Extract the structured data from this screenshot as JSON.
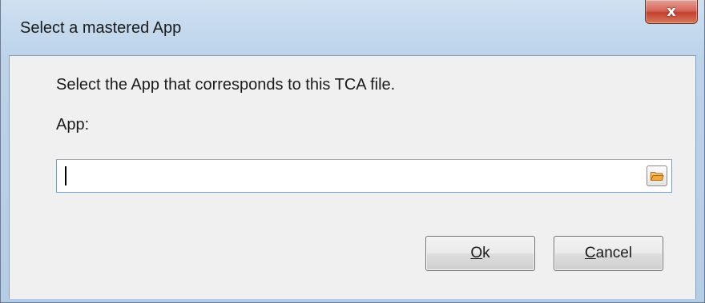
{
  "window": {
    "title": "Select a mastered App",
    "close_glyph": "x",
    "close_icon": "close-icon"
  },
  "dialog": {
    "instruction": "Select the App that corresponds to this TCA file.",
    "app_label": "App:",
    "app_field": {
      "value": "",
      "placeholder": ""
    },
    "browse_icon": "folder-open-icon"
  },
  "buttons": {
    "ok": {
      "mnemonic": "O",
      "rest": "k"
    },
    "cancel": {
      "mnemonic": "C",
      "rest": "ancel"
    }
  },
  "colors": {
    "title_bar": "#bcd3ea",
    "client_bg": "#f0f0f0",
    "close_button": "#c4412f",
    "folder_icon": "#f4a83a"
  }
}
